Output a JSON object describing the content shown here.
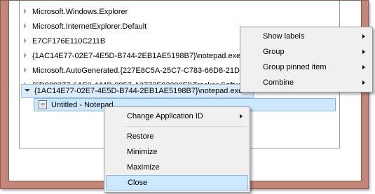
{
  "tree": {
    "rows": [
      {
        "label": "Microsoft.Windows.Explorer"
      },
      {
        "label": "Microsoft.InternetExplorer.Default"
      },
      {
        "label": "E7CF176E110C211B"
      },
      {
        "label": "{1AC14E77-02E7-4E5D-B744-2EB1AE5198B7}\\notepad.exe"
      },
      {
        "label": "Microsoft.AutoGenerated.{227E8C5A-25C7-C783-66D8-21D55"
      },
      {
        "label": "{6D809377-6AF0-444B-8957-A3773F02200E}\\Tracker Softwar"
      },
      {
        "label": "{1AC14E77-02E7-4E5D-B744-2EB1AE5198B7}\\notepad.exe"
      }
    ],
    "child": {
      "label": "Untitled - Notepad"
    }
  },
  "labels_menu": {
    "items": [
      {
        "label": "Show labels"
      },
      {
        "label": "Group"
      },
      {
        "label": "Group pinned item"
      },
      {
        "label": "Combine"
      }
    ]
  },
  "window_menu": {
    "change_app_id": "Change Application ID",
    "restore": "Restore",
    "minimize": "Minimize",
    "maximize": "Maximize",
    "close": "Close"
  }
}
